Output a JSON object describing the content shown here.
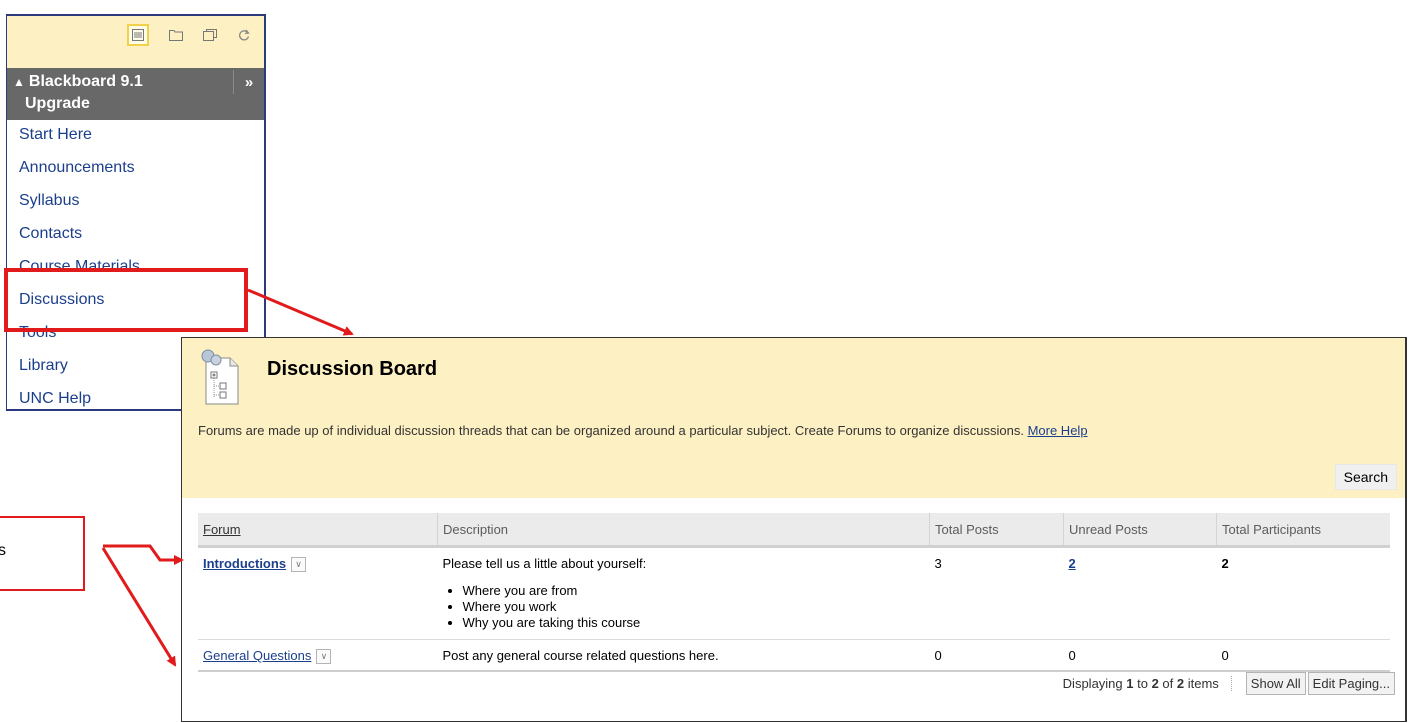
{
  "course_menu": {
    "title_line1": "Blackboard 9.1",
    "title_line2": "Upgrade",
    "items": [
      "Start Here",
      "Announcements",
      "Syllabus",
      "Contacts",
      "Course Materials",
      "Discussions",
      "Tools",
      "Library",
      "UNC Help"
    ]
  },
  "annotation": {
    "callout_text": "s",
    "highlight_color": "#e11b1b"
  },
  "board": {
    "title": "Discussion Board",
    "description": "Forums are made up of individual discussion threads that can be organized around a particular subject. Create Forums to organize discussions.",
    "help_link": "More Help",
    "search_label": "Search",
    "columns": [
      "Forum",
      "Description",
      "Total Posts",
      "Unread Posts",
      "Total Participants"
    ],
    "rows": [
      {
        "forum": "Introductions",
        "description": "Please tell us a little about yourself:",
        "bullets": [
          "Where you are from",
          "Where you work",
          "Why you are taking this course"
        ],
        "total_posts": "3",
        "unread_posts": "2",
        "total_participants": "2"
      },
      {
        "forum": "General Questions",
        "description": "Post any general course related questions here.",
        "total_posts": "0",
        "unread_posts": "0",
        "total_participants": "0"
      }
    ],
    "paging": {
      "prefix": "Displaying ",
      "from": "1",
      "mid": " to ",
      "to": "2",
      "of": " of ",
      "total": "2",
      "suffix": " items"
    },
    "show_all_label": "Show All",
    "edit_paging_label": "Edit Paging..."
  }
}
